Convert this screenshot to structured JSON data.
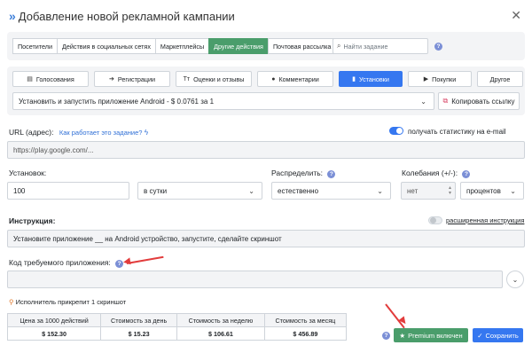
{
  "header": {
    "title": "Добавление новой рекламной кампании"
  },
  "tabs": [
    {
      "label": "Посетители"
    },
    {
      "label": "Действия в социальных сетях"
    },
    {
      "label": "Маркетплейсы"
    },
    {
      "label": "Другие действия",
      "active": true
    },
    {
      "label": "Почтовая рассылка"
    }
  ],
  "search": {
    "placeholder": "Найти задание"
  },
  "categories": [
    {
      "label": "Голосования",
      "icon": "document-icon"
    },
    {
      "label": "Регистрации",
      "icon": "login-icon"
    },
    {
      "label": "Оценки и отзывы",
      "icon": "text-icon"
    },
    {
      "label": "Комментарии",
      "icon": "comment-icon"
    },
    {
      "label": "Установки",
      "icon": "phone-icon",
      "active": true
    },
    {
      "label": "Покупки",
      "icon": "youtube-icon"
    },
    {
      "label": "Другое",
      "icon": ""
    }
  ],
  "task": {
    "selected": "Установить и запустить приложение Android - $ 0.0761 за 1",
    "copy_label": "Копировать ссылку"
  },
  "url": {
    "label": "URL (адрес):",
    "help_link": "Как работает это задание?",
    "placeholder": "https://play.google.com/...",
    "stats_label": "получать статистику на e-mail"
  },
  "installs": {
    "label": "Установок:",
    "value": "100",
    "period": "в сутки"
  },
  "distribute": {
    "label": "Распределить:",
    "value": "естественно"
  },
  "fluctuation": {
    "label": "Колебания (+/-):",
    "value": "нет",
    "unit": "процентов"
  },
  "instruction": {
    "label": "Инструкция:",
    "advanced_label": "расширенная инструкция",
    "value": "Установите приложение __ на Android устройство, запустите, сделайте скриншот"
  },
  "app_code": {
    "label": "Код требуемого приложения:"
  },
  "attach_note": "Исполнитель прикрепит 1 скриншот",
  "prices": {
    "headers": [
      "Цена за 1000 действий",
      "Стоимость за день",
      "Стоимость за неделю",
      "Стоимость за месяц"
    ],
    "values": [
      "$ 152.30",
      "$ 15.23",
      "$ 106.61",
      "$ 456.89"
    ]
  },
  "actions": {
    "premium_label": "Premium включен",
    "save_label": "Сохранить"
  },
  "colors": {
    "primary": "#3577f0",
    "success": "#4a9d6b",
    "annotation": "#e23c3c"
  }
}
